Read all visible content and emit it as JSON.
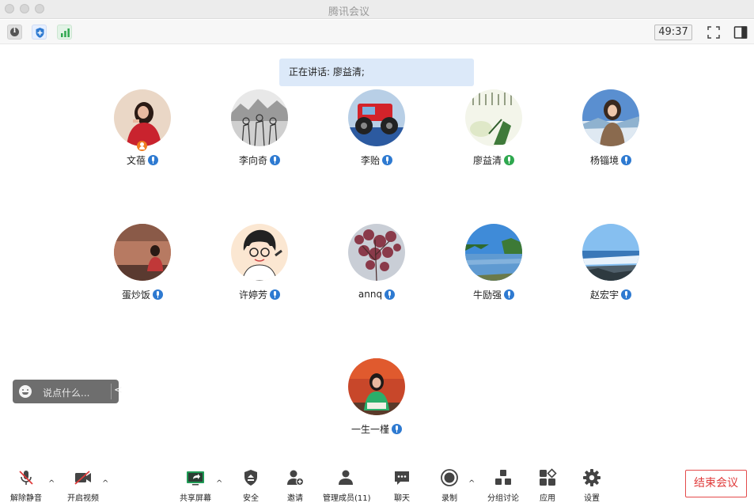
{
  "window": {
    "title": "腾讯会议"
  },
  "topbar": {
    "timer": "49:37",
    "info_glyph": "i"
  },
  "speaking": {
    "text": "正在讲话: 廖益清;"
  },
  "participants": [
    {
      "name": "文蓓",
      "mic": "blue",
      "host": true
    },
    {
      "name": "李向奇",
      "mic": "blue"
    },
    {
      "name": "李贻",
      "mic": "blue"
    },
    {
      "name": "廖益清",
      "mic": "green"
    },
    {
      "name": "杨锱境",
      "mic": "blue"
    },
    {
      "name": "蛋炒饭",
      "mic": "blue"
    },
    {
      "name": "许婷芳",
      "mic": "blue"
    },
    {
      "name": "annq",
      "mic": "blue"
    },
    {
      "name": "牛励强",
      "mic": "blue"
    },
    {
      "name": "赵宏宇",
      "mic": "blue"
    },
    {
      "name": "一生一槿",
      "mic": "blue"
    }
  ],
  "chat": {
    "placeholder": "说点什么...",
    "collapse": "<"
  },
  "toolbar": {
    "unmute": "解除静音",
    "start_video": "开启视频",
    "share_screen": "共享屏幕",
    "security": "安全",
    "invite": "邀请",
    "manage_members": "管理成员(11)",
    "chat": "聊天",
    "record": "录制",
    "breakout": "分组讨论",
    "apps": "应用",
    "settings": "设置",
    "end_meeting": "结束会议"
  },
  "colors": {
    "accent_blue": "#2e7ad1",
    "speaking_bg": "#dce9f9",
    "end_red": "#e03a3a",
    "active_mic_green": "#2fa84f"
  }
}
